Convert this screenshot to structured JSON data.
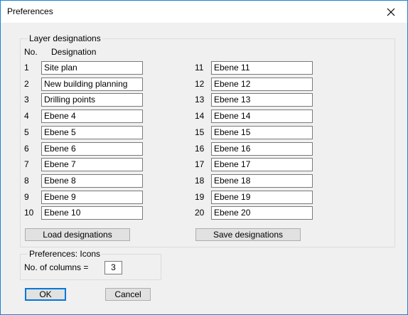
{
  "window": {
    "title": "Preferences"
  },
  "layer_group": {
    "legend": "Layer designations",
    "col_no": "No.",
    "col_designation": "Designation",
    "rows": [
      {
        "no": "1",
        "value": "Site plan"
      },
      {
        "no": "2",
        "value": "New building planning"
      },
      {
        "no": "3",
        "value": "Drilling points"
      },
      {
        "no": "4",
        "value": "Ebene 4"
      },
      {
        "no": "5",
        "value": "Ebene 5"
      },
      {
        "no": "6",
        "value": "Ebene 6"
      },
      {
        "no": "7",
        "value": "Ebene 7"
      },
      {
        "no": "8",
        "value": "Ebene 8"
      },
      {
        "no": "9",
        "value": "Ebene 9"
      },
      {
        "no": "10",
        "value": "Ebene 10"
      },
      {
        "no": "11",
        "value": "Ebene 11"
      },
      {
        "no": "12",
        "value": "Ebene 12"
      },
      {
        "no": "13",
        "value": "Ebene 13"
      },
      {
        "no": "14",
        "value": "Ebene 14"
      },
      {
        "no": "15",
        "value": "Ebene 15"
      },
      {
        "no": "16",
        "value": "Ebene 16"
      },
      {
        "no": "17",
        "value": "Ebene 17"
      },
      {
        "no": "18",
        "value": "Ebene 18"
      },
      {
        "no": "19",
        "value": "Ebene 19"
      },
      {
        "no": "20",
        "value": "Ebene 20"
      }
    ],
    "load_button": "Load designations",
    "save_button": "Save designations"
  },
  "icons_group": {
    "legend": "Preferences: Icons",
    "columns_label": "No. of columns =",
    "columns_value": "3"
  },
  "buttons": {
    "ok": "OK",
    "cancel": "Cancel"
  },
  "colors": {
    "accent": "#0078d7",
    "window_border": "#1883d7",
    "background": "#f0f0f0"
  },
  "icons": {
    "close": "close-icon"
  }
}
